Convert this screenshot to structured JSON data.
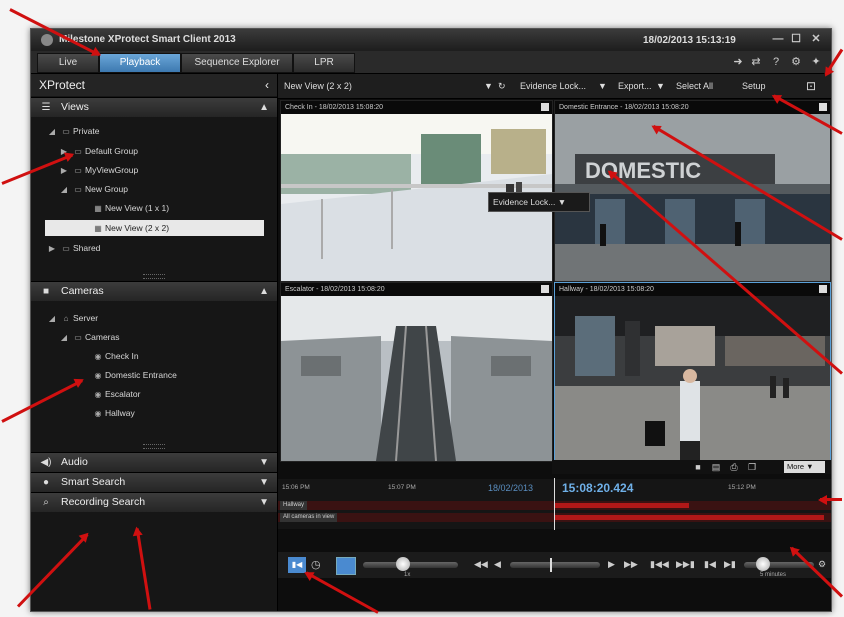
{
  "window": {
    "title": "Milestone XProtect Smart Client 2013",
    "clock": "18/02/2013 15:13:19",
    "buttons": [
      "—",
      "☐",
      "✕"
    ]
  },
  "tabs": [
    {
      "label": "Live",
      "active": false
    },
    {
      "label": "Playback",
      "active": true
    },
    {
      "label": "Sequence Explorer",
      "active": false
    },
    {
      "label": "LPR",
      "active": false
    }
  ],
  "sidebar": {
    "header": "XProtect",
    "collapse_glyph": "‹",
    "views": {
      "label": "Views",
      "items": [
        {
          "label": "Private",
          "expand": "◢"
        },
        {
          "label": "Default Group",
          "expand": "▶"
        },
        {
          "label": "MyViewGroup",
          "expand": "▶"
        },
        {
          "label": "New Group",
          "expand": "◢"
        },
        {
          "label": "New View (1 x 1)",
          "expand": ""
        },
        {
          "label": "New View (2 x 2)",
          "expand": ""
        },
        {
          "label": "Shared",
          "expand": "▶"
        }
      ]
    },
    "cameras": {
      "label": "Cameras",
      "items": [
        {
          "label": "Server",
          "expand": "◢"
        },
        {
          "label": "Cameras",
          "expand": "◢"
        },
        {
          "label": "Check In",
          "expand": ""
        },
        {
          "label": "Domestic Entrance",
          "expand": ""
        },
        {
          "label": "Escalator",
          "expand": ""
        },
        {
          "label": "Hallway",
          "expand": ""
        }
      ]
    },
    "audio": {
      "label": "Audio"
    },
    "smart_search": {
      "label": "Smart Search"
    },
    "recording_search": {
      "label": "Recording Search"
    }
  },
  "toolbar": {
    "view_select": "New View (2 x 2)",
    "evidence_lock": "Evidence Lock...",
    "export": "Export...",
    "select_all": "Select All",
    "setup": "Setup"
  },
  "tiles": [
    {
      "caption": "Check In - 18/02/2013 15:08:20",
      "selected": false
    },
    {
      "caption": "Domestic Entrance - 18/02/2013 15:08:20",
      "selected": false
    },
    {
      "caption": "Escalator - 18/02/2013 15:08:20",
      "selected": false
    },
    {
      "caption": "Hallway - 18/02/2013 15:08:20",
      "selected": true
    }
  ],
  "popup": {
    "label": "Evidence Lock..."
  },
  "tile_controls": {
    "more": "More"
  },
  "timeline": {
    "ticks": [
      "15:06 PM",
      "15:07 PM",
      "15:12 PM"
    ],
    "date": "18/02/2013",
    "current_time": "15:08:20.424",
    "tracks": [
      "Hallway",
      "All cameras in view"
    ]
  },
  "transport": {
    "speed_label": "1x",
    "interval_label": "5 minutes"
  },
  "colors": {
    "accent": "#3d79b0",
    "annotation_arrow": "#d01010",
    "recording": "#b01818"
  }
}
